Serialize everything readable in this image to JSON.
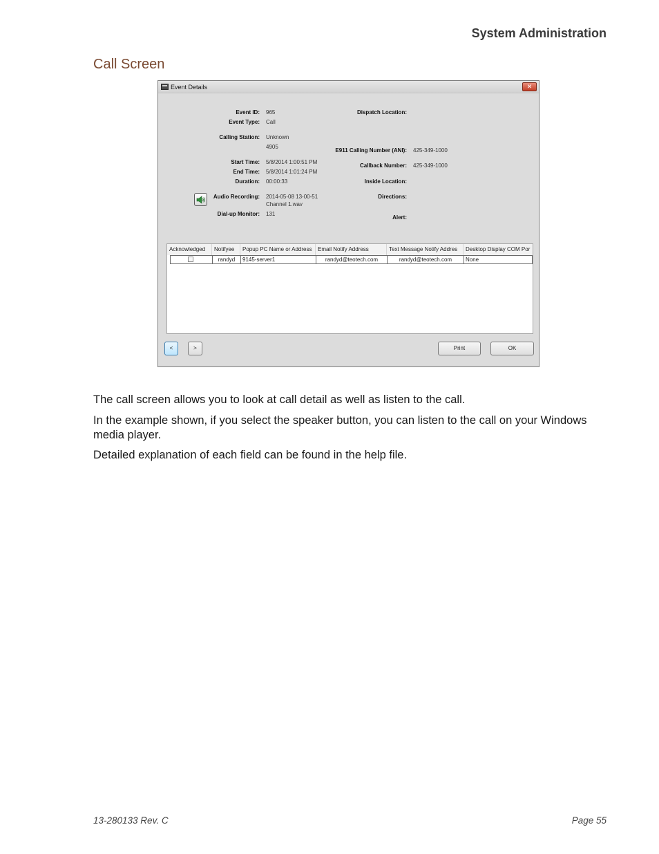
{
  "header": {
    "title": "System Administration"
  },
  "section": {
    "title": "Call Screen"
  },
  "dialog": {
    "title": "Event Details",
    "close_label": "✕",
    "labels": {
      "event_id": "Event ID:",
      "event_type": "Event Type:",
      "calling_station": "Calling Station:",
      "start_time": "Start Time:",
      "end_time": "End Time:",
      "duration": "Duration:",
      "audio_recording": "Audio Recording:",
      "dialup_monitor": "Dial-up Monitor:",
      "dispatch_location": "Dispatch Location:",
      "e911": "E911 Calling Number (ANI):",
      "callback_number": "Callback Number:",
      "inside_location": "Inside Location:",
      "directions": "Directions:",
      "alert": "Alert:"
    },
    "values": {
      "event_id": "965",
      "event_type": "Call",
      "calling_station": "Unknown",
      "calling_station_2": "4905",
      "start_time": "5/8/2014 1:00:51 PM",
      "end_time": "5/8/2014 1:01:24 PM",
      "duration": "00:00:33",
      "audio_recording": "2014-05-08 13-00-51",
      "audio_recording_2": "Channel 1.wav",
      "dialup_monitor": "131",
      "e911": "425-349-1000",
      "callback_number": "425-349-1000"
    },
    "grid": {
      "columns": [
        "Acknowledged",
        "Notifyee",
        "Popup PC Name or Address",
        "Email Notify Address",
        "Text Message Notify Addres",
        "Desktop Display COM Por"
      ],
      "row": {
        "notifyee": "randyd",
        "popup": "9145-server1",
        "email": "randyd@teotech.com",
        "text": "randyd@teotech.com",
        "desktop": "None"
      }
    },
    "buttons": {
      "prev": "<",
      "next": ">",
      "print": "Print",
      "ok": "OK"
    }
  },
  "body": {
    "p1": "The call screen allows you to look at call detail as well as listen to the call.",
    "p2": "In the example shown, if you select the speaker button, you can listen to the call on your Windows media player.",
    "p3": "Detailed explanation of each field can be found in the help file."
  },
  "footer": {
    "doc_number": "13-280133  Rev. C",
    "page": "Page 55"
  }
}
